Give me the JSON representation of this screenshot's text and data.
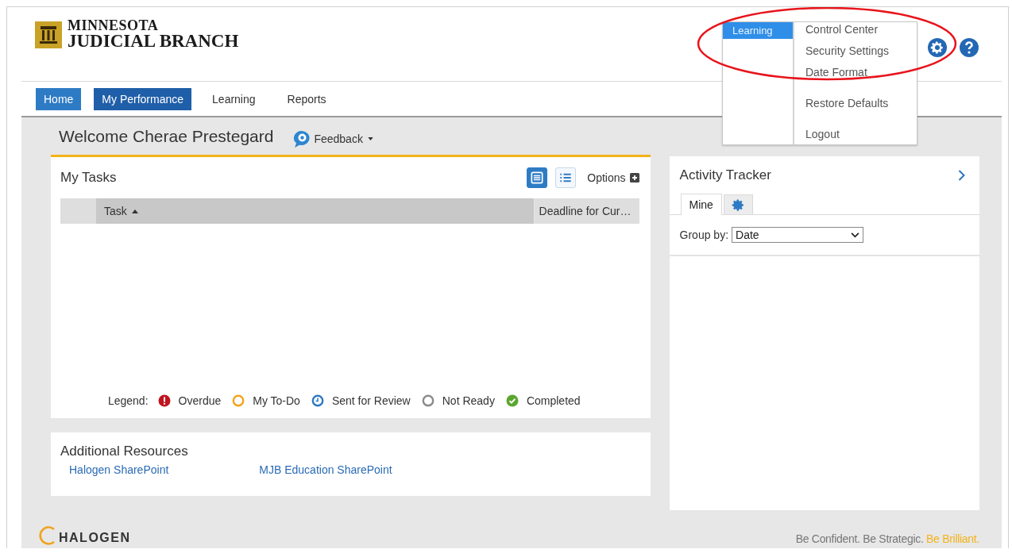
{
  "logo": {
    "line_1": "MINNESOTA",
    "line_2": "JUDICIAL BRANCH"
  },
  "nav": [
    {
      "label": "Home",
      "kind": "button",
      "selected": false
    },
    {
      "label": "My Performance",
      "kind": "button",
      "selected": true
    },
    {
      "label": "Learning",
      "kind": "link",
      "selected": false
    },
    {
      "label": "Reports",
      "kind": "link",
      "selected": false
    }
  ],
  "welcome": {
    "title": "Welcome Cherae Prestegard",
    "feedback": "Feedback"
  },
  "tasks": {
    "title": "My Tasks",
    "views": [
      {
        "kind": "cards",
        "selected": true
      },
      {
        "kind": "list",
        "selected": false
      }
    ],
    "options": "Options",
    "columns": [
      {
        "label": "Task",
        "sorted": true
      },
      {
        "label": "Deadline for Cur…",
        "sorted": false
      }
    ],
    "legend_label": "Legend:",
    "legend": [
      {
        "label": "Overdue",
        "kind": "alert",
        "color": "#c0151f"
      },
      {
        "label": "My To-Do",
        "kind": "ring",
        "color": "#f4a21a"
      },
      {
        "label": "Sent for Review",
        "kind": "clock",
        "color": "#2f78c4"
      },
      {
        "label": "Not Ready",
        "kind": "ring",
        "color": "#8a8a8a"
      },
      {
        "label": "Completed",
        "kind": "check",
        "color": "#5aa62e"
      }
    ]
  },
  "resources": {
    "title": "Additional Resources",
    "links": [
      "Halogen SharePoint",
      "MJB Education SharePoint"
    ]
  },
  "activity": {
    "title": "Activity Tracker",
    "tabs": [
      {
        "label": "Mine",
        "kind": "text",
        "selected": true
      },
      {
        "kind": "gear",
        "selected": false
      }
    ],
    "group_by_label": "Group by:",
    "group_by_value": "Date"
  },
  "menu": {
    "sections": [
      {
        "label": "Learning",
        "selected": true
      }
    ],
    "groups": [
      [
        "Control Center",
        "Security Settings",
        "Date Format"
      ],
      [
        "Restore Defaults"
      ],
      [
        "Logout"
      ]
    ]
  },
  "footer": {
    "brand": "HALOGEN",
    "tagline": "Be Confident. Be Strategic.",
    "tagline_accent": "Be Brilliant."
  }
}
